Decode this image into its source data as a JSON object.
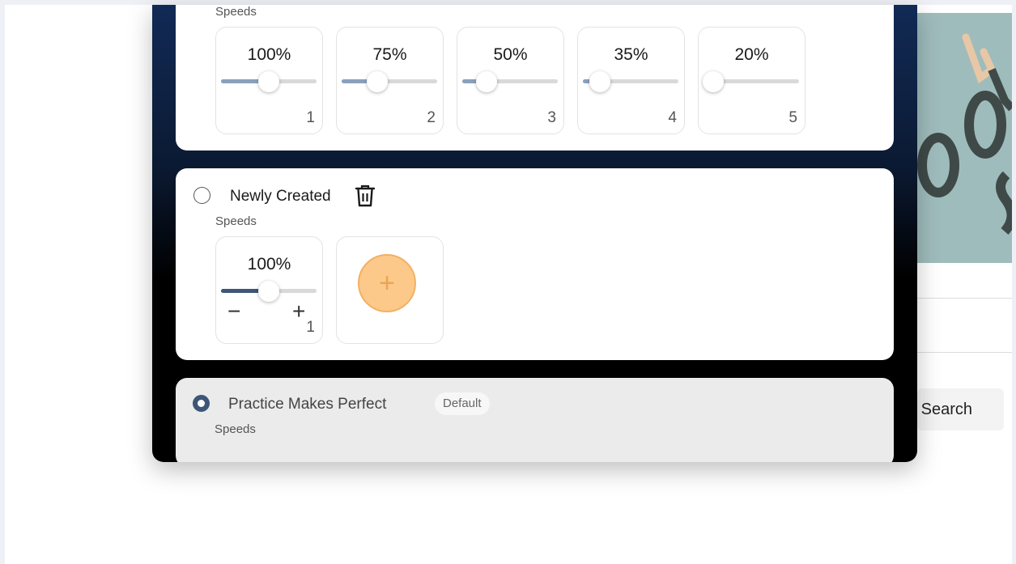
{
  "speed_sets": [
    {
      "speeds_label": "Speeds",
      "tiles": [
        {
          "percent": "100%",
          "value": 100,
          "index": "1"
        },
        {
          "percent": "75%",
          "value": 75,
          "index": "2"
        },
        {
          "percent": "50%",
          "value": 50,
          "index": "3"
        },
        {
          "percent": "35%",
          "value": 35,
          "index": "4"
        },
        {
          "percent": "20%",
          "value": 20,
          "index": "5"
        }
      ]
    },
    {
      "name": "Newly Created",
      "speeds_label": "Speeds",
      "selected": false,
      "tiles": [
        {
          "percent": "100%",
          "value": 100,
          "index": "1",
          "minus": "−",
          "plus": "+"
        }
      ],
      "add_tile": {
        "icon": "plus-icon",
        "symbol": "+"
      }
    },
    {
      "name": "Practice Makes Perfect",
      "badge": "Default",
      "speeds_label": "Speeds",
      "selected": true
    }
  ],
  "background": {
    "search_label": "e Search"
  },
  "colors": {
    "accent": "#3d5678",
    "slider_fill": "#8aa0bc",
    "add_button": "#fcc98a"
  }
}
